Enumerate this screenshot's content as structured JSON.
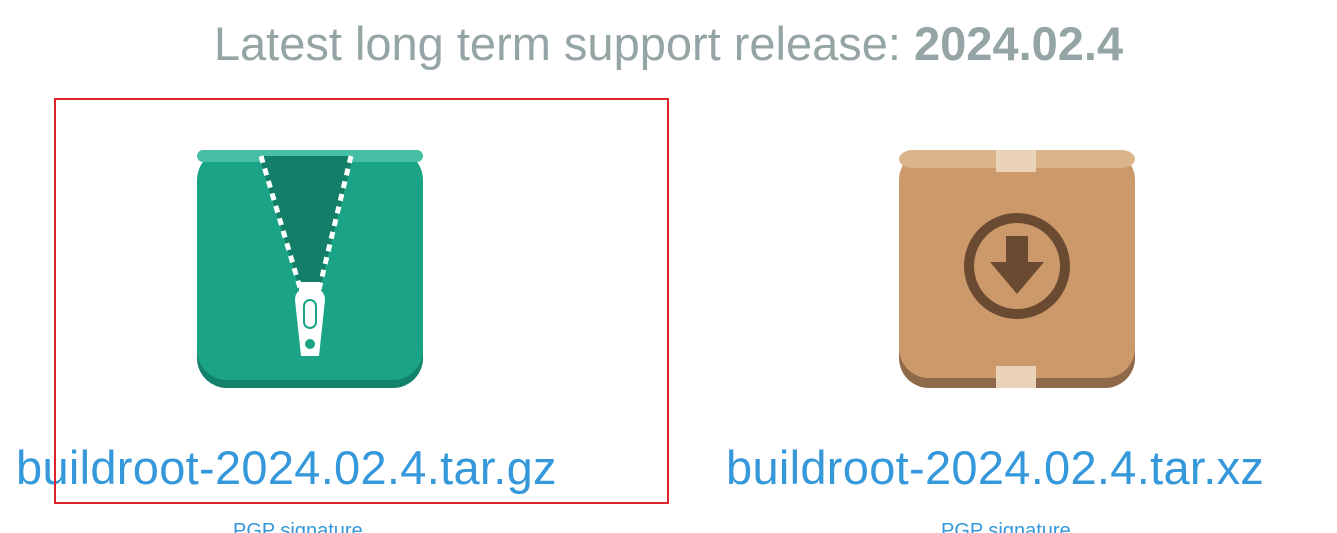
{
  "heading": {
    "prefix": "Latest long term support release: ",
    "version": "2024.02.4"
  },
  "downloads": [
    {
      "filename": "buildroot-2024.02.4.tar.gz",
      "signature_label": "PGP signature",
      "icon": "zip-archive-icon",
      "icon_color": "#1aa385"
    },
    {
      "filename": "buildroot-2024.02.4.tar.xz",
      "signature_label": "PGP signature",
      "icon": "package-box-download-icon",
      "icon_color": "#cc9a6a"
    }
  ],
  "colors": {
    "heading": "#95a5a6",
    "link": "#3498db",
    "highlight": "#e0242b"
  }
}
